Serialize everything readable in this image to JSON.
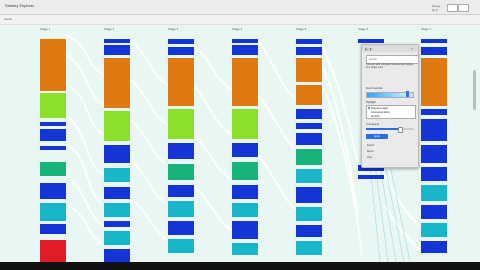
{
  "window": {
    "title": "Sankey Explorer"
  },
  "toolbar": {
    "select_label": "Group by ▾"
  },
  "subbar": {
    "label": "Fields"
  },
  "columns": [
    {
      "header": "Stage 1"
    },
    {
      "header": "Stage 2"
    },
    {
      "header": "Stage 3"
    },
    {
      "header": "Stage 4"
    },
    {
      "header": "Stage 5"
    },
    {
      "header": "Stage 6"
    },
    {
      "header": "Stage 7"
    }
  ],
  "popover": {
    "search_placeholder": "Search",
    "description": "Connect and compare flows across stages in a single view",
    "section_a_label": "Flow threshold",
    "threshold_percent": 92,
    "list_title": "Highlight",
    "options": [
      "Selected nodes",
      "Connected paths",
      "All links"
    ],
    "section_b_label": "Link opacity",
    "opacity_percent": 70,
    "apply_label": "Apply",
    "links": [
      "Export",
      "Reset",
      "Help"
    ]
  },
  "colors": {
    "orange": "#e07a10",
    "green": "#8de02a",
    "blue": "#1534d6",
    "teal": "#19b6c9",
    "emerald": "#18b37a",
    "red": "#e01c28",
    "link": "#bfe8e1"
  }
}
